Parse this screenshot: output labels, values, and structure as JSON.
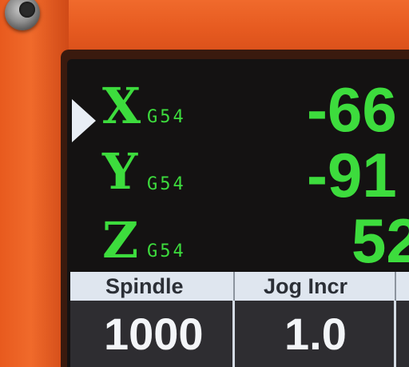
{
  "axes": [
    {
      "axis": "X",
      "frame": "G54",
      "value": "-66",
      "selected": true
    },
    {
      "axis": "Y",
      "frame": "G54",
      "value": "-91",
      "selected": false
    },
    {
      "axis": "Z",
      "frame": "G54",
      "value": "52",
      "selected": false
    }
  ],
  "status_bar": {
    "spindle_label": "Spindle",
    "jog_label": "Jog Incr",
    "spindle_value": "1000",
    "jog_value": "1.0"
  },
  "colors": {
    "axis_text": "#3ddc3d",
    "housing": "#e85a1e",
    "screen_bg": "#141212",
    "header_bg": "#dfe6ef"
  },
  "icons": {
    "pointer": "selection-triangle-icon",
    "screw": "hex-screw-icon"
  }
}
